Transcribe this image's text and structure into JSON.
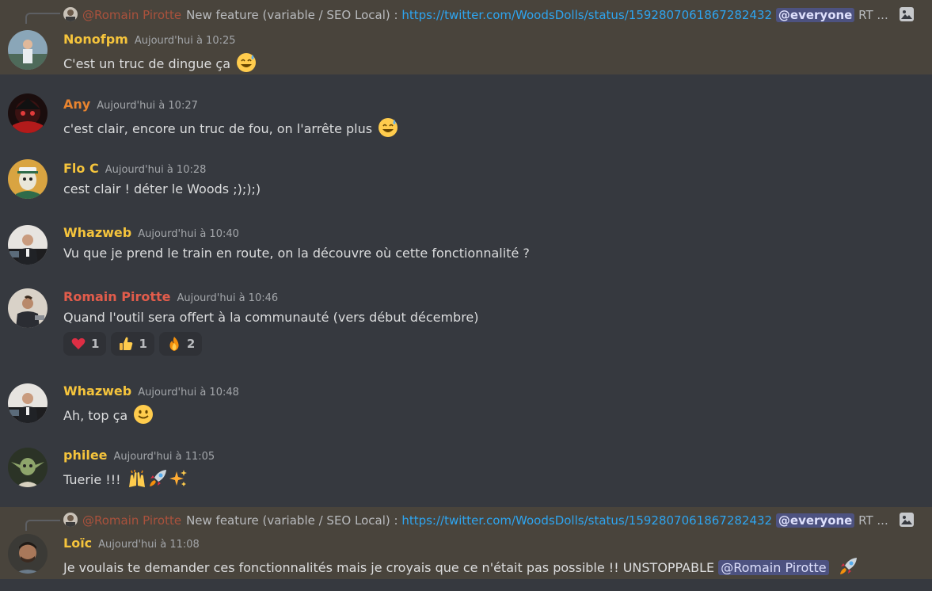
{
  "colors": {
    "background": "#36393f",
    "highlight": "#49443c",
    "username_yellow": "#f5c43c",
    "username_orange": "#e8842f",
    "username_red": "#e25c4b",
    "link": "#2ea5f0",
    "mention_bg": "#4d5280"
  },
  "reply1": {
    "author": "@Romain Pirotte",
    "text": "New feature (variable / SEO Local) : ",
    "link": "https://twitter.com/WoodsDolls/status/1592807061867282432",
    "mention": "@everyone",
    "tail": "RT ...",
    "icon": "image-icon"
  },
  "reply2": {
    "author": "@Romain Pirotte",
    "text": "New feature (variable / SEO Local) : ",
    "link": "https://twitter.com/WoodsDolls/status/1592807061867282432",
    "mention": "@everyone",
    "tail": "RT ...",
    "icon": "image-icon"
  },
  "messages": [
    {
      "author": "Nonofpm",
      "time": "Aujourd'hui à 10:25",
      "text": "C'est un truc de dingue ça",
      "emoji": "sweat-smile-icon"
    },
    {
      "author": "Any",
      "time": "Aujourd'hui à 10:27",
      "text": "c'est clair, encore un truc de fou, on l'arrête plus",
      "emoji": "sweat-smile-icon"
    },
    {
      "author": "Flo C",
      "time": "Aujourd'hui à 10:28",
      "text": "cest clair ! déter le Woods ;););)"
    },
    {
      "author": "Whazweb",
      "time": "Aujourd'hui à 10:40",
      "text": "Vu que je prend le train en route, on la découvre où cette fonctionnalité ?"
    },
    {
      "author": "Romain Pirotte",
      "time": "Aujourd'hui à 10:46",
      "text": "Quand l'outil sera offert à la communauté (vers début décembre)",
      "reactions": [
        {
          "icon": "heart-icon",
          "count": "1"
        },
        {
          "icon": "thumbs-up-icon",
          "count": "1"
        },
        {
          "icon": "fire-icon",
          "count": "2"
        }
      ]
    },
    {
      "author": "Whazweb",
      "time": "Aujourd'hui à 10:48",
      "text": "Ah, top ça",
      "emoji": "slight-smile-icon"
    },
    {
      "author": "philee",
      "time": "Aujourd'hui à 11:05",
      "text": "Tuerie !!!",
      "emoji": "raised-hands-rocket-sparkles-icon"
    },
    {
      "author": "Loïc",
      "time": "Aujourd'hui à 11:08",
      "text": "Je voulais te demander ces fonctionnalités mais je croyais que ce n'était pas possible !! UNSTOPPABLE ",
      "mention": "@Romain Pirotte",
      "emoji": "rocket-icon"
    }
  ]
}
